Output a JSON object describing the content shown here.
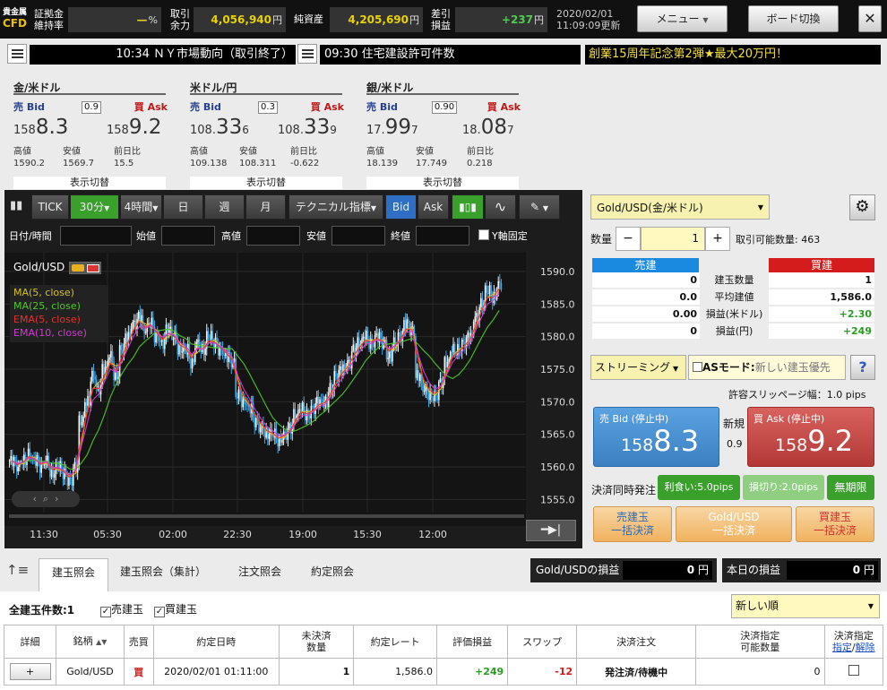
{
  "header": {
    "logo_top": "貴金属",
    "logo_bottom": "CFD",
    "margin_label_1": "証拠金",
    "margin_label_2": "維持率",
    "margin_value": "—",
    "margin_unit": "%",
    "avail_label_1": "取引",
    "avail_label_2": "余力",
    "avail_value": "4,056,940",
    "avail_unit": "円",
    "equity_label": "純資産",
    "equity_value": "4,205,690",
    "equity_unit": "円",
    "pnl_label_1": "差引",
    "pnl_label_2": "損益",
    "pnl_value": "+237",
    "pnl_unit": "円",
    "date": "2020/02/01",
    "time_updated": "11:09:09更新",
    "menu_label": "メニュー",
    "board_label": "ボード切換",
    "close_label": "✕"
  },
  "ticker": {
    "news_1": "10:34 ＮＹ市場動向（取引終了）",
    "news_2": "09:30 住宅建設許可件数",
    "promo": "創業15周年記念第2弾★最大20万円！"
  },
  "rates": [
    {
      "name": "金/米ドル",
      "bid_label": "売 Bid",
      "ask_label": "買 Ask",
      "spread": "0.9",
      "bid_pre": "158",
      "bid_big": "8.3",
      "bid_post": "",
      "ask_pre": "158",
      "ask_big": "9.2",
      "ask_post": "",
      "high_label": "高値",
      "low_label": "安値",
      "chg_label": "前日比",
      "high": "1590.2",
      "low": "1569.7",
      "chg": "15.5",
      "switch": "表示切替"
    },
    {
      "name": "米ドル/円",
      "bid_label": "売 Bid",
      "ask_label": "買 Ask",
      "spread": "0.3",
      "bid_pre": "108.",
      "bid_big": "33",
      "bid_post": "6",
      "ask_pre": "108.",
      "ask_big": "33",
      "ask_post": "9",
      "high_label": "高値",
      "low_label": "安値",
      "chg_label": "前日比",
      "high": "109.138",
      "low": "108.311",
      "chg": "-0.622",
      "switch": "表示切替"
    },
    {
      "name": "銀/米ドル",
      "bid_label": "売 Bid",
      "ask_label": "買 Ask",
      "spread": "0.90",
      "bid_pre": "17.",
      "bid_big": "99",
      "bid_post": "7",
      "ask_pre": "18.",
      "ask_big": "08",
      "ask_post": "7",
      "high_label": "高値",
      "low_label": "安値",
      "chg_label": "前日比",
      "high": "18.139",
      "low": "17.749",
      "chg": "0.218",
      "switch": "表示切替"
    }
  ],
  "chart_toolbar": {
    "tick": "TICK",
    "min30": "30分",
    "h4": "4時間",
    "day": "日",
    "week": "週",
    "month": "月",
    "tech": "テクニカル指標",
    "bid": "Bid",
    "ask": "Ask"
  },
  "chart_fields": {
    "datetime": "日付/時間",
    "open": "始値",
    "high": "高値",
    "low": "安値",
    "close": "終値",
    "yfix": "Y軸固定"
  },
  "chart_data": {
    "type": "candlestick",
    "title": "Gold/USD",
    "legend": [
      "MA(5, close)",
      "MA(25, close)",
      "EMA(5, close)",
      "EMA(10, close)"
    ],
    "legend_colors": [
      "#d8c020",
      "#4ec82a",
      "#e83030",
      "#d23ad2"
    ],
    "x_ticks": [
      "11:30",
      "05:30",
      "02:00",
      "22:30",
      "19:00",
      "15:30",
      "12:00"
    ],
    "y_ticks": [
      1590.0,
      1585.0,
      1580.0,
      1575.0,
      1570.0,
      1565.0,
      1560.0,
      1555.0
    ],
    "ylim": [
      1553.0,
      1591.5
    ],
    "close_series": [
      1561,
      1560,
      1561,
      1562,
      1561,
      1560,
      1561,
      1559,
      1560,
      1559,
      1558,
      1560,
      1567,
      1570,
      1574,
      1572,
      1575,
      1577,
      1574,
      1578,
      1580,
      1582,
      1583,
      1581,
      1582,
      1580,
      1579,
      1581,
      1580,
      1578,
      1578,
      1576,
      1579,
      1578,
      1580,
      1579,
      1578,
      1577,
      1576,
      1571,
      1570,
      1569,
      1567,
      1566,
      1565,
      1565,
      1564,
      1565,
      1566,
      1568,
      1569,
      1568,
      1569,
      1570,
      1570,
      1572,
      1574,
      1575,
      1576,
      1578,
      1579,
      1580,
      1579,
      1580,
      1579,
      1577,
      1579,
      1580,
      1582,
      1581,
      1574,
      1572,
      1571,
      1571,
      1573,
      1576,
      1578,
      1578,
      1579,
      1580,
      1583,
      1585,
      1587,
      1586,
      1588
    ]
  },
  "order": {
    "symbol": "Gold/USD(金/米ドル)",
    "qty_label": "数量",
    "qty": "1",
    "avail_label": "取引可能数量: 463",
    "sell_hdr": "売建",
    "buy_hdr": "買建",
    "rows": [
      {
        "label": "建玉数量",
        "sell": "0",
        "buy": "1"
      },
      {
        "label": "平均建値",
        "sell": "0.0",
        "buy": "1,586.0"
      },
      {
        "label": "損益(米ドル)",
        "sell": "0.00",
        "buy": "+2.30"
      },
      {
        "label": "損益(円)",
        "sell": "0",
        "buy": "+249"
      }
    ],
    "streaming": "ストリーミング",
    "as_mode": "ASモード:",
    "as_hint": "新しい建玉優先",
    "help": "?",
    "slippage": "許容スリッページ幅：1.0 pips",
    "sell_btn_label": "売 Bid (停止中)",
    "sell_pre": "158",
    "sell_big": "8.3",
    "new_label": "新規",
    "spread": "0.9",
    "buy_btn_label": "買 Ask (停止中)",
    "buy_pre": "158",
    "buy_big": "9.2",
    "settle_label": "決済同時発注",
    "tp": "利食い:5.0pips",
    "sl": "損切り:2.0pips",
    "nolimit": "無期限",
    "close_sell_1": "売建玉",
    "close_sell_2": "一括決済",
    "close_all_1": "Gold/USD",
    "close_all_2": "一括決済",
    "close_buy_1": "買建玉",
    "close_buy_2": "一括決済"
  },
  "tabs": {
    "t1": "建玉照会",
    "t2": "建玉照会（集計）",
    "t3": "注文照会",
    "t4": "約定照会",
    "pnl_label": "Gold/USDの損益",
    "pnl_value": "0",
    "pnl_unit": "円",
    "today_label": "本日の損益",
    "today_value": "0",
    "today_unit": "円"
  },
  "positions": {
    "count_label": "全建玉件数:1",
    "filter_sell": "売建玉",
    "filter_buy": "買建玉",
    "sort": "新しい順",
    "headers": [
      "詳細",
      "銘柄",
      "売買",
      "約定日時",
      "未決済",
      "数量",
      "約定レート",
      "評価損益",
      "スワップ",
      "決済注文",
      "決済指定",
      "可能数量",
      "決済指定",
      "指定",
      "解除"
    ],
    "row": {
      "detail": "+",
      "symbol": "Gold/USD",
      "side": "買",
      "datetime": "2020/02/01 01:11:00",
      "qty": "1",
      "rate": "1,586.0",
      "pnl": "+249",
      "swap": "-12",
      "order": "発注済/待機中",
      "avail": "0"
    }
  }
}
